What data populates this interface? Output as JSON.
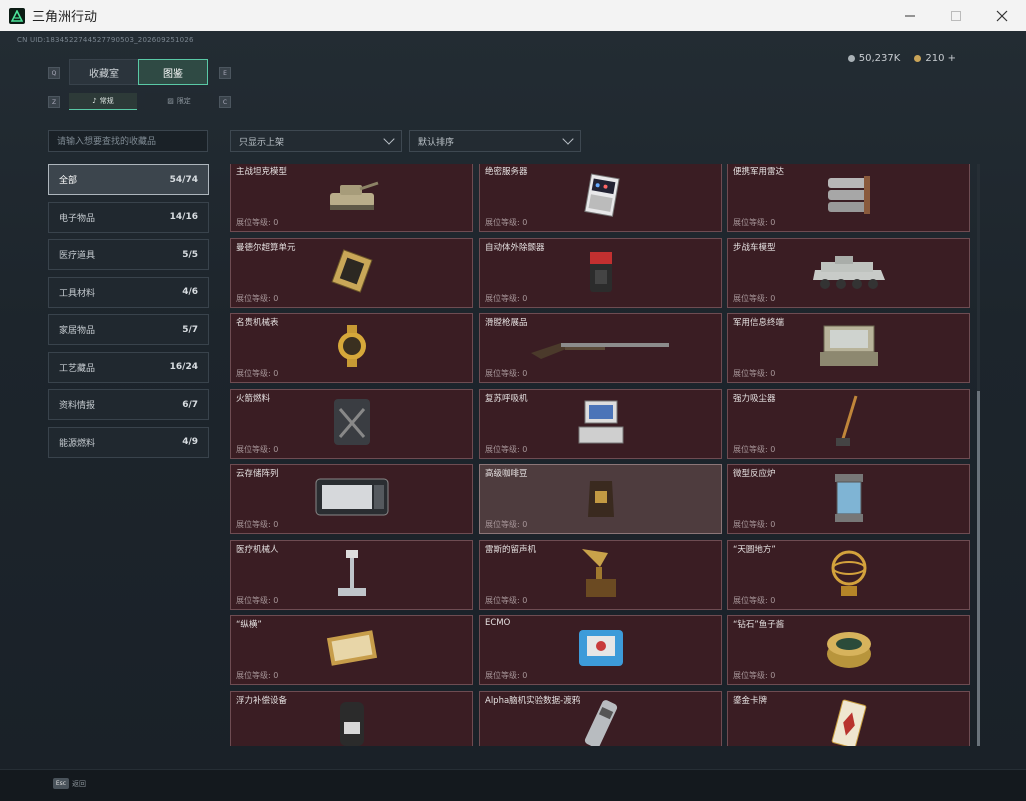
{
  "window": {
    "title": "三角洲行动"
  },
  "header": {
    "uid": "CN UID:1834522744527790503_202609251026",
    "currency": [
      {
        "icon": "silver-coin-icon",
        "value": "50,237K"
      },
      {
        "icon": "gold-coin-icon",
        "value": "210 +"
      }
    ]
  },
  "tabs": [
    {
      "label": "收藏室",
      "active": false
    },
    {
      "label": "图鉴",
      "active": true
    }
  ],
  "subtabs": [
    {
      "label": "常规",
      "icon": "music-note-icon",
      "active": true
    },
    {
      "label": "限定",
      "icon": "photo-icon",
      "active": false
    }
  ],
  "search": {
    "placeholder": "请输入想要查找的收藏品"
  },
  "categories": [
    {
      "label": "全部",
      "count": "54/74",
      "active": true
    },
    {
      "label": "电子物品",
      "count": "14/16"
    },
    {
      "label": "医疗道具",
      "count": "5/5"
    },
    {
      "label": "工具材料",
      "count": "4/6"
    },
    {
      "label": "家居物品",
      "count": "5/7"
    },
    {
      "label": "工艺藏品",
      "count": "16/24"
    },
    {
      "label": "资料情报",
      "count": "6/7"
    },
    {
      "label": "能源燃料",
      "count": "4/9"
    }
  ],
  "filters": {
    "display": "只显示上架",
    "sort": "默认排序"
  },
  "level_label": "展位等级: 0",
  "items": [
    {
      "name": "主战坦克模型",
      "icon": "tank-icon"
    },
    {
      "name": "绝密服务器",
      "icon": "server-icon"
    },
    {
      "name": "便携军用雷达",
      "icon": "radar-icon"
    },
    {
      "name": "曼德尔超算单元",
      "icon": "compute-unit-icon"
    },
    {
      "name": "自动体外除颤器",
      "icon": "defibrillator-icon"
    },
    {
      "name": "步战车模型",
      "icon": "ifv-icon"
    },
    {
      "name": "名贵机械表",
      "icon": "watch-icon"
    },
    {
      "name": "滑膛枪展品",
      "icon": "musket-icon"
    },
    {
      "name": "军用信息终端",
      "icon": "terminal-icon"
    },
    {
      "name": "火箭燃料",
      "icon": "fuel-icon"
    },
    {
      "name": "复苏呼吸机",
      "icon": "ventilator-icon"
    },
    {
      "name": "强力吸尘器",
      "icon": "vacuum-icon"
    },
    {
      "name": "云存储阵列",
      "icon": "storage-array-icon"
    },
    {
      "name": "高级咖啡豆",
      "icon": "coffee-bag-icon",
      "highlight": true
    },
    {
      "name": "微型反应炉",
      "icon": "reactor-icon"
    },
    {
      "name": "医疗机械人",
      "icon": "medical-robot-icon"
    },
    {
      "name": "雷斯的留声机",
      "icon": "gramophone-icon"
    },
    {
      "name": "“天圆地方”",
      "icon": "armillary-icon"
    },
    {
      "name": "“纵横”",
      "icon": "chessboard-icon"
    },
    {
      "name": "ECMO",
      "icon": "ecmo-icon"
    },
    {
      "name": "“钻石”鱼子酱",
      "icon": "caviar-icon"
    },
    {
      "name": "浮力补偿设备",
      "icon": "bcd-icon"
    },
    {
      "name": "Alpha脑机实验数据-渡鸦",
      "icon": "data-drive-icon"
    },
    {
      "name": "鎏金卡牌",
      "icon": "gilded-card-icon"
    }
  ],
  "footer": {
    "key": "Esc",
    "label": "返回"
  }
}
